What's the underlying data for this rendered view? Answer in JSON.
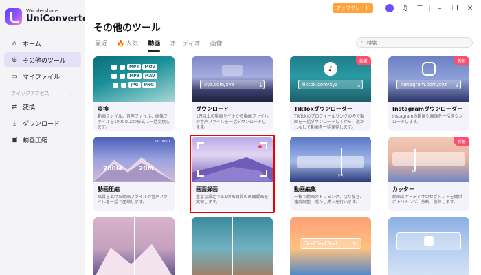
{
  "app": {
    "brand_small": "Wondershare",
    "brand_name": "UniConverter"
  },
  "sidebar": {
    "items": [
      {
        "label": "ホーム",
        "icon": "home-icon"
      },
      {
        "label": "その他のツール",
        "icon": "tools-icon",
        "active": true
      },
      {
        "label": "マイファイル",
        "icon": "file-icon"
      }
    ],
    "section_label": "クイックアクセス",
    "quick": [
      {
        "label": "変換",
        "icon": "convert-icon"
      },
      {
        "label": "ダウンロード",
        "icon": "download-icon"
      },
      {
        "label": "動画圧縮",
        "icon": "compress-icon"
      }
    ]
  },
  "topbar": {
    "upgrade_label": "アップグレード"
  },
  "page": {
    "title": "その他のツール"
  },
  "tabs": [
    {
      "label": "最近"
    },
    {
      "label": "人気",
      "icon": "fire-icon"
    },
    {
      "label": "動画",
      "active": true
    },
    {
      "label": "オーディオ"
    },
    {
      "label": "画像"
    }
  ],
  "search": {
    "placeholder": "検索"
  },
  "cards": [
    {
      "title": "変換",
      "desc": "動画ファイル、音声ファイル、画像ファイルを1000以上の形式に一括変換します。",
      "formats": [
        "MP4",
        "MOV",
        "MP3",
        "MAV",
        "JPG",
        "PNG"
      ]
    },
    {
      "title": "ダウンロード",
      "desc": "1万以上の動画サイトから動画ファイルや音声ファイルを一括ダウンロードします。",
      "url": "xyz.com/xyz"
    },
    {
      "title": "TikTokダウンローダー",
      "desc": "TikTokのプロフィールリンクのみで動画を一括ダウンロードしてから、透かしなしで動画を一括保存します。",
      "url": "tiktok.com/xyz",
      "badge": "新着"
    },
    {
      "title": "Instagramダウンローダー",
      "desc": "Instagramの動画や画像を一括ダウンロードします。",
      "url": "instagram.com/xyz",
      "badge": "新着"
    },
    {
      "title": "動画圧縮",
      "desc": "品質を上げた動画ファイルや音声ファイルを一括で圧縮します。",
      "size_from": "200M",
      "size_to": "20M",
      "timestamp": "00:00:01"
    },
    {
      "title": "画面録画",
      "desc": "豊富な設定で1:1の画面質の画面録画を実現します。"
    },
    {
      "title": "動画編集",
      "desc": "一枚で動画のトリミング、切り抜き、速度調整、透かし挿入を行います。"
    },
    {
      "title": "カッター",
      "desc": "動画とオーディオのセグメントを簡単にトリミング、分割、削除します。",
      "badge": "新着"
    },
    {
      "title": "",
      "desc": ""
    },
    {
      "title": "",
      "desc": ""
    },
    {
      "title": "",
      "desc": "",
      "text_sample": "TextTextText"
    },
    {
      "title": "",
      "desc": ""
    }
  ]
}
